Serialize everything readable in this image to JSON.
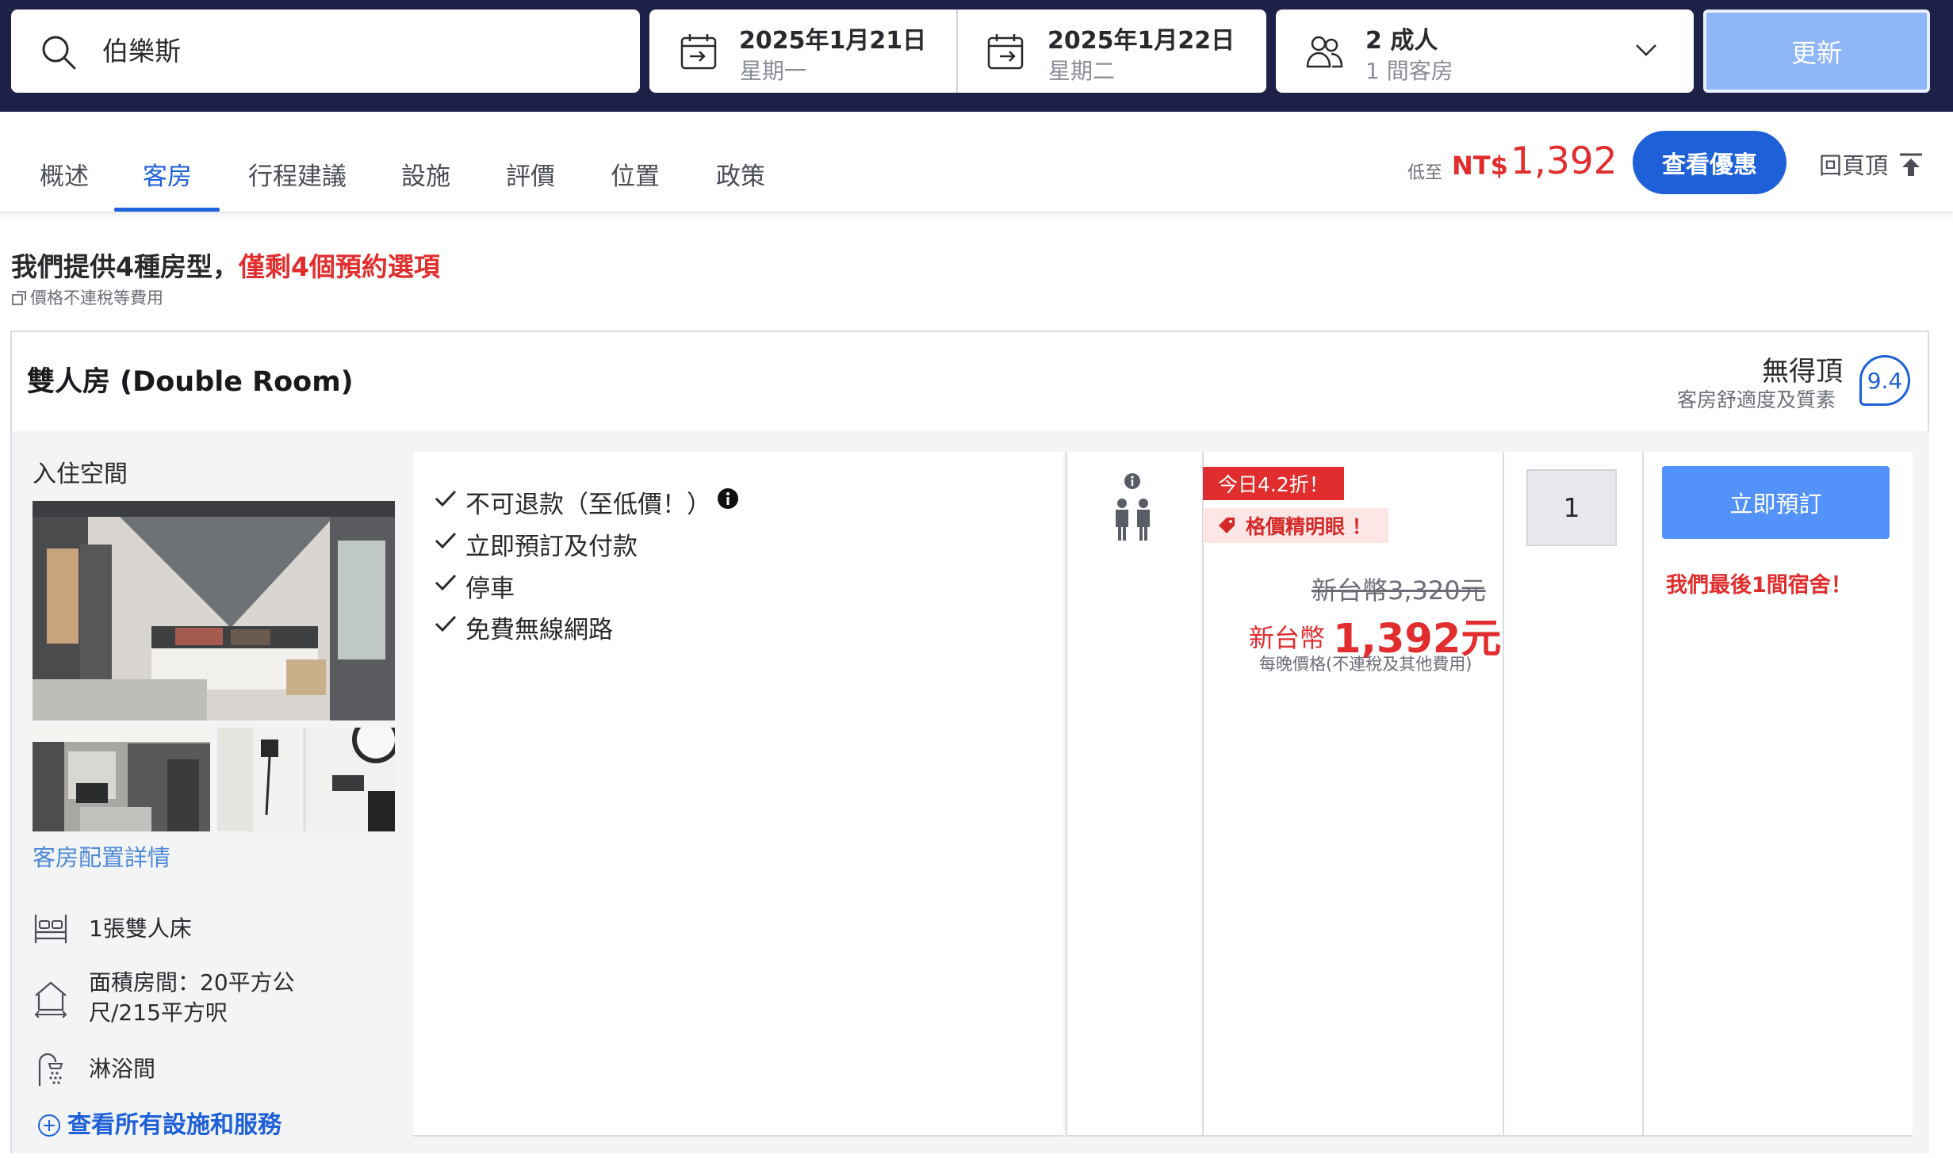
{
  "search": {
    "destination": "伯樂斯"
  },
  "dates": {
    "checkin": {
      "date": "2025年1月21日",
      "weekday": "星期一"
    },
    "checkout": {
      "date": "2025年1月22日",
      "weekday": "星期二"
    }
  },
  "occupancy": {
    "guests": "2 成人",
    "rooms": "1 間客房"
  },
  "update_label": "更新",
  "tabs": [
    "概述",
    "客房",
    "行程建議",
    "設施",
    "評價",
    "位置",
    "政策"
  ],
  "active_tab": "客房",
  "lowest": {
    "prefix": "低至",
    "currency": "NT$",
    "price": "1,392"
  },
  "deal_button": "查看優惠",
  "back_to_top": "回頁頂",
  "heading": {
    "main": "我們提供4種房型，",
    "highlight": "僅剩4個預約選項",
    "tax_note": "價格不連稅等費用"
  },
  "room": {
    "title": "雙人房 (Double Room)",
    "review_word": "無得頂",
    "review_sub": "客房舒適度及質素",
    "score": "9.4",
    "occupancy_label": "入住空間",
    "detail_link": "客房配置詳情",
    "features": [
      {
        "icon": "bed-icon",
        "text": "1張雙人床"
      },
      {
        "icon": "house-icon",
        "text": "面積房間：20平方公尺/215平方呎"
      },
      {
        "icon": "shower-icon",
        "text": "淋浴間"
      }
    ],
    "see_all": "查看所有設施和服務",
    "conditions": [
      "不可退款（至低價！）",
      "立即預訂及付款",
      "停車",
      "免費無線網路"
    ],
    "badge_today": "今日4.2折！",
    "badge_value": "格價精明眼 ！",
    "old_price": "新台幣3,320元",
    "new_price_currency": "新台幣",
    "new_price": "1,392元",
    "per_night": "每晚價格(不連稅及其他費用)",
    "quantity": "1",
    "book_button": "立即預訂",
    "last_room": "我們最後1間宿舍！"
  },
  "colors": {
    "brand_blue": "#1e60d8",
    "price_red": "#e12d2d",
    "header_navy": "#1d2147",
    "book_blue": "#5392f9"
  }
}
